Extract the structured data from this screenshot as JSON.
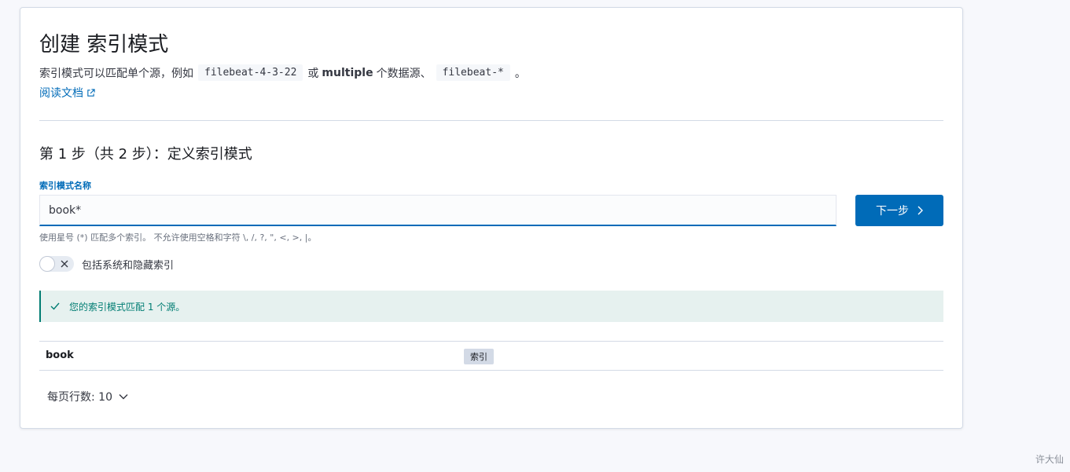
{
  "header": {
    "title": "创建 索引模式",
    "description_prefix": "索引模式可以匹配单个源，例如",
    "example_single": "filebeat-4-3-22",
    "description_middle_1": "或",
    "description_bold": "multiple",
    "description_middle_2": "个数据源、",
    "example_multi": "filebeat-*",
    "description_suffix": "。",
    "doc_link": "阅读文档"
  },
  "step": {
    "title": "第 1 步（共 2 步）：定义索引模式",
    "field_label": "索引模式名称",
    "input_value": "book*",
    "next_button": "下一步",
    "help_text": "使用星号 (*) 匹配多个索引。 不允许使用空格和字符 \\, /, ?, \", <, >, |。",
    "toggle_label": "包括系统和隐藏索引",
    "toggle_on": false
  },
  "callout": {
    "text": "您的索引模式匹配 1 个源。"
  },
  "results": [
    {
      "name": "book",
      "type": "索引"
    }
  ],
  "pager": {
    "label": "每页行数: 10"
  },
  "watermark": "许大仙",
  "colors": {
    "accent": "#006bb8",
    "success": "#017d73",
    "success_bg": "#e6f1ef"
  }
}
